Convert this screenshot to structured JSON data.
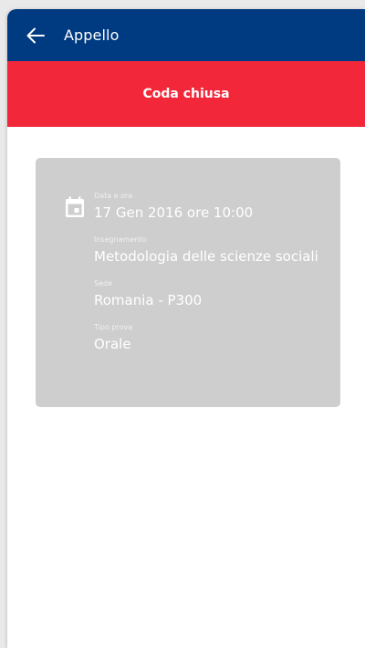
{
  "appbar": {
    "back_icon": "arrow-left-icon",
    "title": "Appello",
    "background": "#003a80"
  },
  "banner": {
    "text": "Coda chiusa",
    "background": "#f2283a"
  },
  "card": {
    "icon": "calendar-icon",
    "background": "#cecece",
    "fields": [
      {
        "label": "Data e ora",
        "value": "17 Gen 2016 ore 10:00"
      },
      {
        "label": "Insegnamento",
        "value": "Metodologia delle scienze sociali"
      },
      {
        "label": "Sede",
        "value": "Romania - P300"
      },
      {
        "label": "Tipo prova",
        "value": "Orale"
      }
    ]
  }
}
